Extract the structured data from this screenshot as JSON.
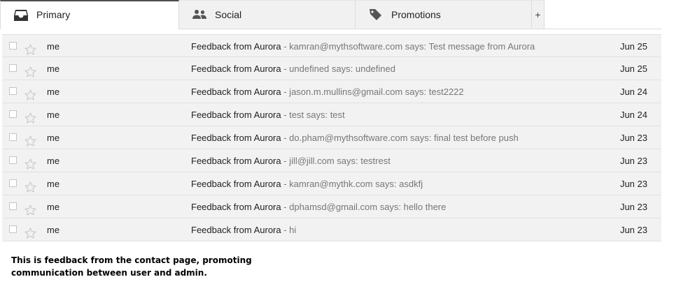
{
  "tabs": [
    {
      "label": "Primary",
      "icon": "inbox-icon",
      "active": true
    },
    {
      "label": "Social",
      "icon": "people-icon",
      "active": false
    },
    {
      "label": "Promotions",
      "icon": "tag-icon",
      "active": false
    }
  ],
  "add_tab_label": "+",
  "emails": [
    {
      "sender": "me",
      "subject": "Feedback from Aurora",
      "snippet": " - kamran@mythsoftware.com says: Test message from Aurora",
      "date": "Jun 25"
    },
    {
      "sender": "me",
      "subject": "Feedback from Aurora",
      "snippet": " - undefined says: undefined",
      "date": "Jun 25"
    },
    {
      "sender": "me",
      "subject": "Feedback from Aurora",
      "snippet": " - jason.m.mullins@gmail.com says: test2222",
      "date": "Jun 24"
    },
    {
      "sender": "me",
      "subject": "Feedback from Aurora",
      "snippet": " - test says: test",
      "date": "Jun 24"
    },
    {
      "sender": "me",
      "subject": "Feedback from Aurora",
      "snippet": " - do.pham@mythsoftware.com says: final test before push",
      "date": "Jun 23"
    },
    {
      "sender": "me",
      "subject": "Feedback from Aurora",
      "snippet": " - jill@jill.com says: testrest",
      "date": "Jun 23"
    },
    {
      "sender": "me",
      "subject": "Feedback from Aurora",
      "snippet": " - kamran@mythk.com says: asdkfj",
      "date": "Jun 23"
    },
    {
      "sender": "me",
      "subject": "Feedback from Aurora",
      "snippet": " - dphamsd@gmail.com says: hello there",
      "date": "Jun 23"
    },
    {
      "sender": "me",
      "subject": "Feedback from Aurora",
      "snippet": " - hi",
      "date": "Jun 23"
    }
  ],
  "caption": {
    "line1": "This is feedback from the contact page, promoting",
    "line2": "communication between user and admin."
  },
  "colors": {
    "row_background": "#f2f2f2",
    "snippet_text": "#777777",
    "active_tab_border": "#4d4d4d"
  }
}
